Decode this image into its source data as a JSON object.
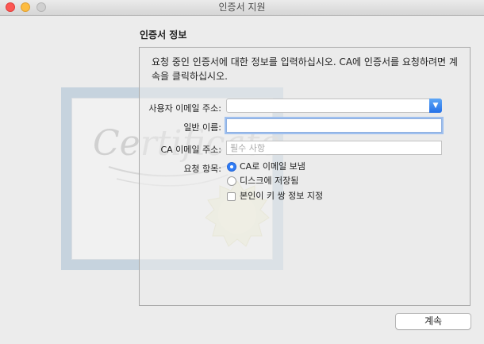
{
  "window": {
    "title": "인증서 지원"
  },
  "section": {
    "title": "인증서 정보"
  },
  "intro": "요청 중인 인증서에 대한 정보를 입력하십시오. CA에 인증서를 요청하려면 계속을 클릭하십시오.",
  "form": {
    "user_email_label": "사용자 이메일 주소:",
    "user_email_value": "",
    "common_name_label": "일반 이름:",
    "common_name_value": "",
    "ca_email_label": "CA 이메일 주소:",
    "ca_email_placeholder": "필수 사항",
    "request_label": "요청 항목:",
    "options": [
      {
        "label": "CA로 이메일 보냄",
        "selected": true
      },
      {
        "label": "디스크에 저장됨",
        "selected": false
      }
    ],
    "keypair_label": "본인이 키 쌍 정보 지정",
    "keypair_checked": false
  },
  "continue_label": "계속",
  "art": {
    "cert_word": "Certificate"
  },
  "colors": {
    "accent": "#2f7cf6",
    "close": "#fc5753",
    "minimize": "#fdbc40"
  }
}
